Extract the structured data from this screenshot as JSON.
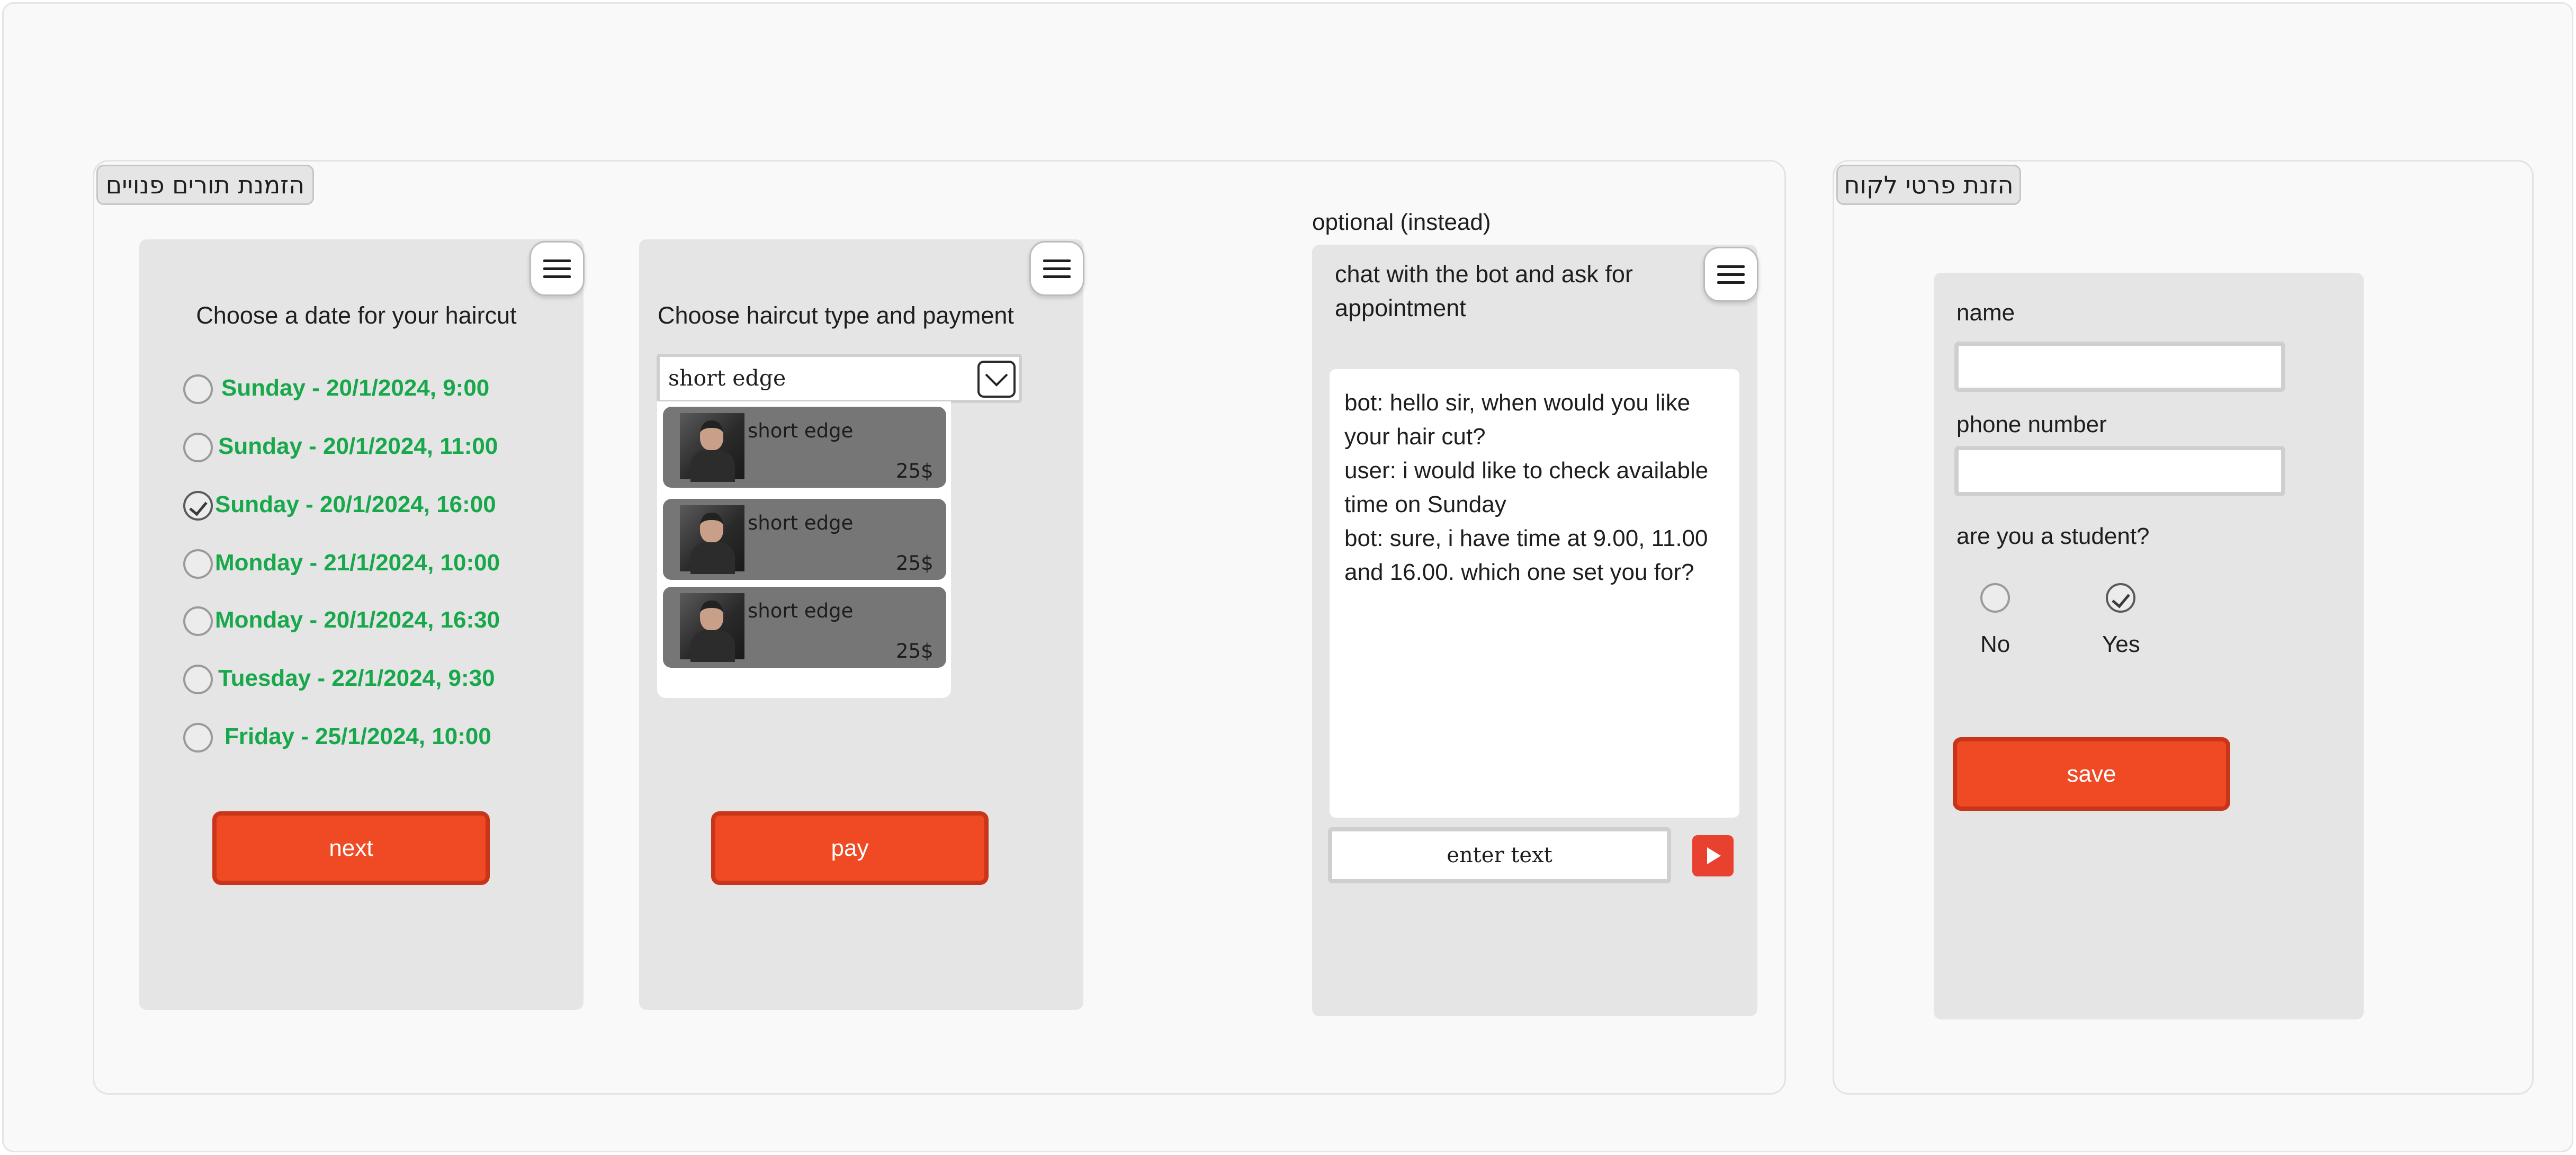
{
  "sections": {
    "booking_label": "הזמנת תורים פנויים",
    "customer_label": "הזנת פרטי לקוח"
  },
  "date_panel": {
    "title": "Choose a date for your haircut",
    "options": [
      {
        "label": "Sunday - 20/1/2024, 9:00",
        "selected": false
      },
      {
        "label": "Sunday - 20/1/2024, 11:00",
        "selected": false
      },
      {
        "label": "Sunday - 20/1/2024, 16:00",
        "selected": true
      },
      {
        "label": "Monday - 21/1/2024, 10:00",
        "selected": false
      },
      {
        "label": "Monday - 20/1/2024, 16:30",
        "selected": false
      },
      {
        "label": "Tuesday - 22/1/2024, 9:30",
        "selected": false
      },
      {
        "label": "Friday - 25/1/2024, 10:00",
        "selected": false
      }
    ],
    "next_label": "next"
  },
  "haircut_panel": {
    "title": "Choose haircut type and payment",
    "select_value": "short edge",
    "items": [
      {
        "name": "short edge",
        "price": "25$"
      },
      {
        "name": "short edge",
        "price": "25$"
      },
      {
        "name": "short edge",
        "price": "25$"
      }
    ],
    "pay_label": "pay"
  },
  "chat_panel": {
    "caption": "optional (instead)",
    "title": "chat with the bot and ask for appointment",
    "messages": [
      "bot: hello sir, when would you like your hair cut?",
      "user: i would like to check available time on Sunday",
      "bot: sure, i have time at 9.00, 11.00 and 16.00. which one set you for?"
    ],
    "input_placeholder": "enter text"
  },
  "customer_panel": {
    "name_label": "name",
    "phone_label": "phone number",
    "student_question": "are you a student?",
    "no_label": "No",
    "yes_label": "Yes",
    "student_selected": "Yes",
    "save_label": "save"
  },
  "colors": {
    "accent": "#f04a24",
    "date_text": "#18a84b",
    "panel_bg": "#e5e5e5"
  },
  "icons": {
    "menu": "hamburger-menu-icon",
    "dropdown": "chevron-down-icon",
    "send": "play-send-icon",
    "check": "check-icon"
  }
}
